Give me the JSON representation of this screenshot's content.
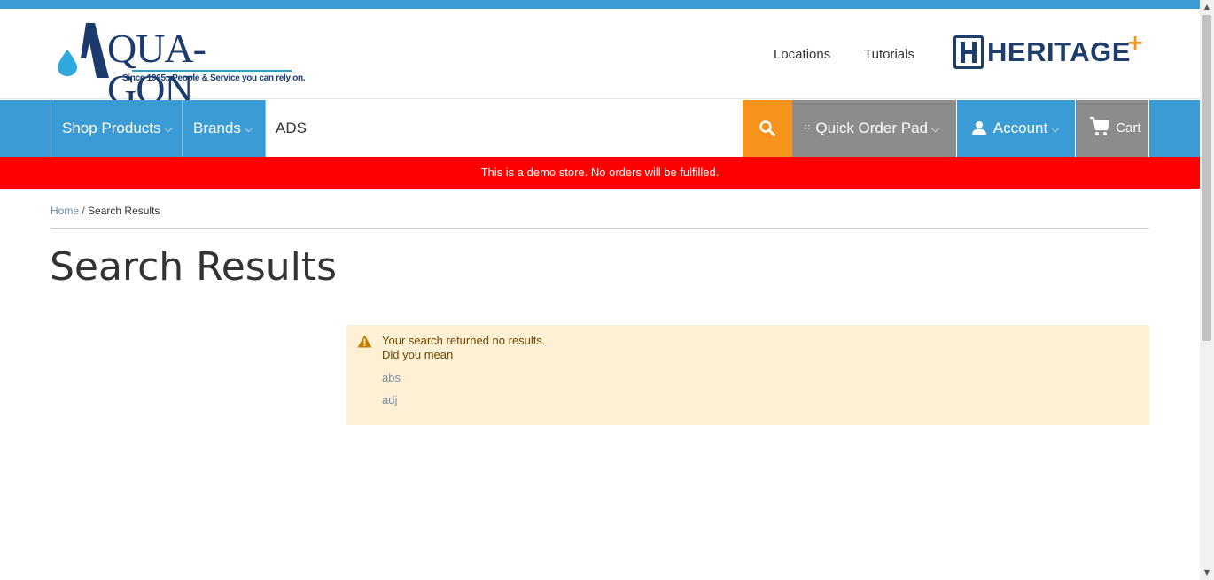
{
  "header": {
    "logo": {
      "name": "QUA-GON",
      "tagline": "Since 1965...People & Service you can rely on."
    },
    "links": [
      "Locations",
      "Tutorials"
    ],
    "partner_logo": {
      "text": "HERITAGE",
      "accent": "+"
    }
  },
  "navbar": {
    "shop_products": "Shop Products",
    "brands": "Brands",
    "search_value": "ADS",
    "quick_order_pad": "Quick Order Pad",
    "account": "Account",
    "cart": "Cart"
  },
  "demo_banner": "This is a demo store. No orders will be fulfilled.",
  "breadcrumb": {
    "home": "Home",
    "separator": "/",
    "current": "Search Results"
  },
  "page_title": "Search Results",
  "notice": {
    "message": "Your search returned no results.",
    "did_you_mean": "Did you mean",
    "suggestions": [
      "abs",
      "adj"
    ]
  },
  "colors": {
    "brand_blue": "#3a9bd5",
    "search_orange": "#f7941d",
    "nav_gray": "#8c8c8c",
    "demo_red": "#ff0000",
    "notice_bg": "#fdf0d5"
  }
}
